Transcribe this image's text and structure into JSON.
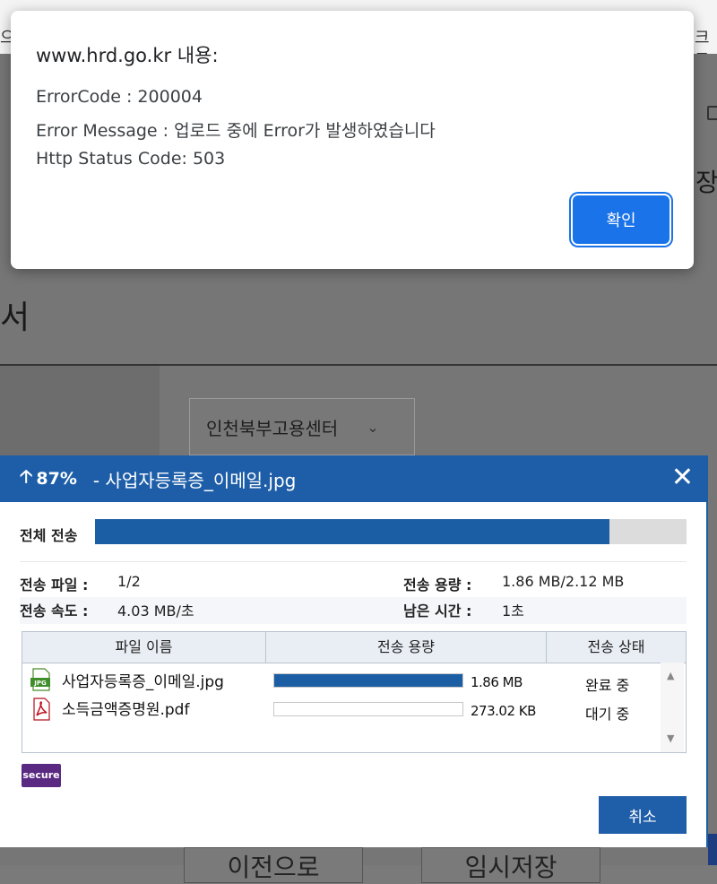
{
  "background_page": {
    "top_left_text": "으",
    "top_right_text": "크롬",
    "right_cut_text": "장",
    "title_partial": "서",
    "office_select": "인천북부고용센터",
    "btn_prev": "이전으로",
    "btn_temp_save": "임시저장"
  },
  "alert": {
    "title": "www.hrd.go.kr 내용:",
    "lines": [
      "ErrorCode : 200004",
      "Error Message : 업로드 중에 Error가 발생하였습니다",
      "Http Status Code: 503"
    ],
    "ok_label": "확인",
    "accent": "#1a73e8"
  },
  "upload": {
    "percent": "87%",
    "percent_value": 87,
    "filename_title": "- 사업자등록증_이메일.jpg",
    "total_label": "전체 전송",
    "info": {
      "files_label": "전송 파일 :",
      "files_value": "1/2",
      "size_label": "전송 용량 :",
      "size_value": "1.86 MB/2.12 MB",
      "speed_label": "전송 속도 :",
      "speed_value": "4.03 MB/초",
      "remaining_label": "남은 시간 :",
      "remaining_value": "1초"
    },
    "columns": [
      "파일 이름",
      "전송 용량",
      "전송 상태"
    ],
    "files": [
      {
        "name": "사업자등록증_이메일.jpg",
        "icon": "jpg-file-icon",
        "progress": 1.0,
        "size": "1.86 MB",
        "status": "완료 중"
      },
      {
        "name": "소득금액증명원.pdf",
        "icon": "pdf-file-icon",
        "progress": 0.0,
        "size": "273.02 KB",
        "status": "대기 중"
      }
    ],
    "secure_label": "secure",
    "cancel_label": "취소",
    "accent": "#1e5ea8"
  }
}
